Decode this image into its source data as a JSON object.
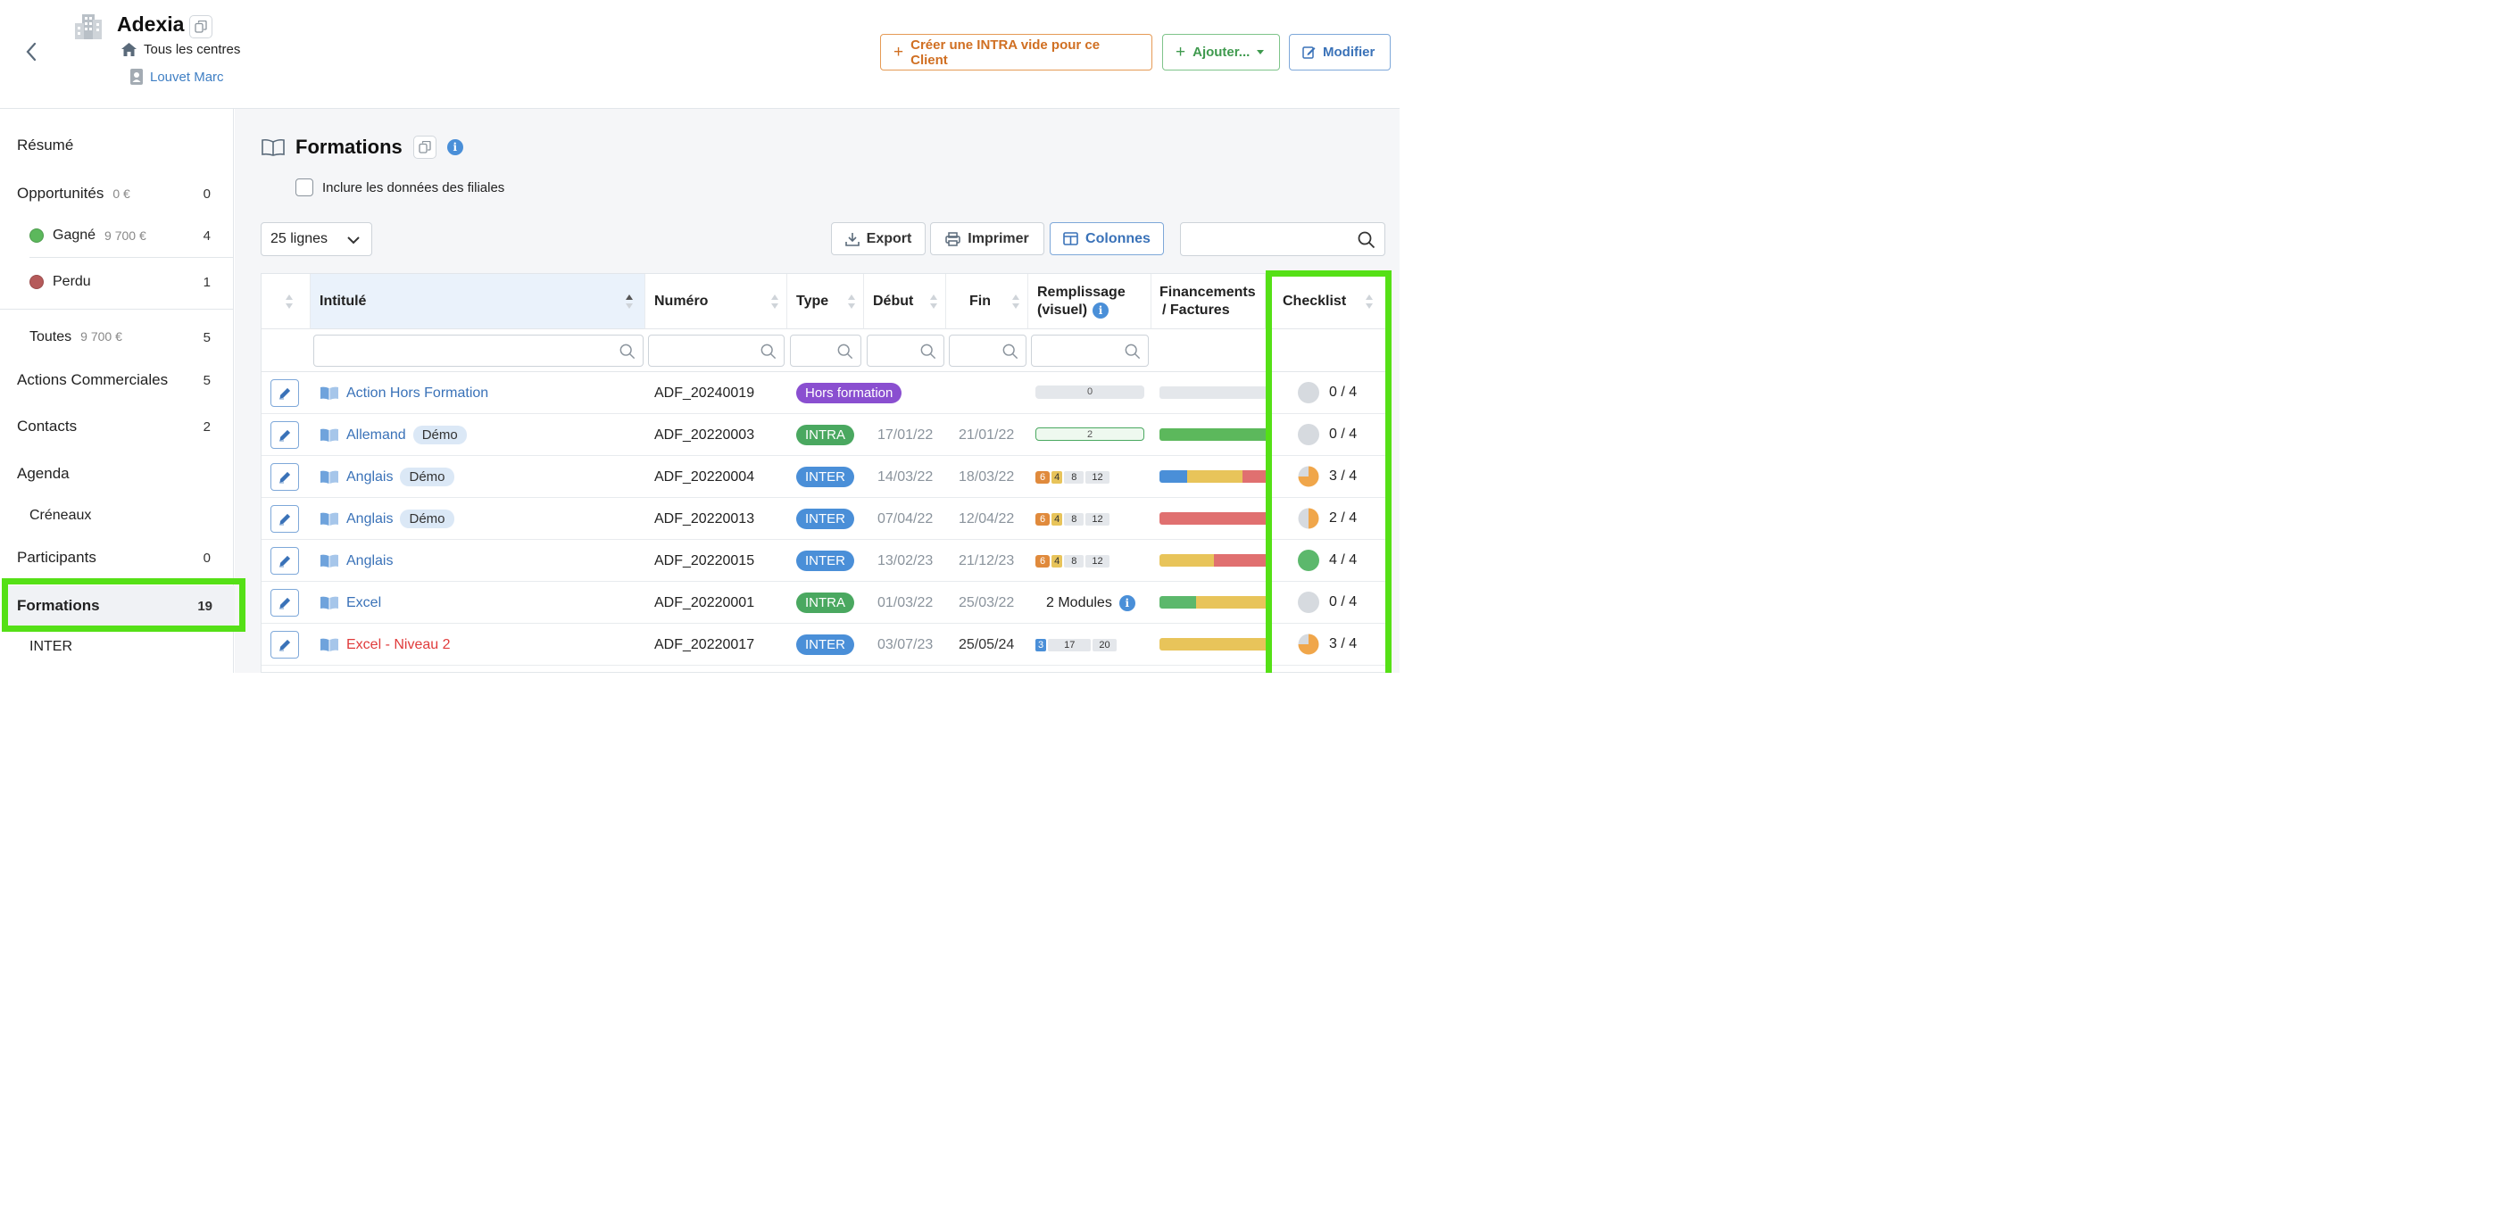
{
  "header": {
    "company": "Adexia",
    "center": "Tous les centres",
    "owner": "Louvet Marc",
    "buttons": {
      "create": "Créer une INTRA vide pour ce Client",
      "add": "Ajouter...",
      "edit": "Modifier"
    }
  },
  "sidebar": {
    "resume": "Résumé",
    "opportunites": {
      "label": "Opportunités",
      "amount": "0 €",
      "count": "0"
    },
    "gagne": {
      "label": "Gagné",
      "amount": "9 700 €",
      "count": "4"
    },
    "perdu": {
      "label": "Perdu",
      "count": "1"
    },
    "toutes": {
      "label": "Toutes",
      "amount": "9 700 €",
      "count": "5"
    },
    "actions": {
      "label": "Actions Commerciales",
      "count": "5"
    },
    "contacts": {
      "label": "Contacts",
      "count": "2"
    },
    "agenda": "Agenda",
    "creneaux": "Créneaux",
    "participants": {
      "label": "Participants",
      "count": "0"
    },
    "formations": {
      "label": "Formations",
      "count": "19"
    },
    "inter": "INTER",
    "colors": {
      "gagne": "#5cb85c",
      "perdu": "#b55a5a"
    }
  },
  "main": {
    "title": "Formations",
    "include_label": "Inclure les données des filiales",
    "rows_select": "25 lignes",
    "export": "Export",
    "print": "Imprimer",
    "columns": "Colonnes",
    "search_placeholder": ""
  },
  "table": {
    "headers": {
      "intitule": "Intitulé",
      "numero": "Numéro",
      "type": "Type",
      "debut": "Début",
      "fin": "Fin",
      "remplissage1": "Remplissage",
      "remplissage2": "(visuel)",
      "financements1": "Financements",
      "financements2": "/ Factures",
      "checklist": "Checklist"
    },
    "rows": [
      {
        "title": "Action Hors Formation",
        "demo": "",
        "numero": "ADF_20240019",
        "type": "Hors formation",
        "debut": "",
        "fin": "",
        "fill": "0",
        "checklist": "0 / 4"
      },
      {
        "title": "Allemand",
        "demo": "Démo",
        "numero": "ADF_20220003",
        "type": "INTRA",
        "debut": "17/01/22",
        "fin": "21/01/22",
        "fill": "2",
        "checklist": "0 / 4"
      },
      {
        "title": "Anglais",
        "demo": "Démo",
        "numero": "ADF_20220004",
        "type": "INTER",
        "debut": "14/03/22",
        "fin": "18/03/22",
        "fill": [
          "6",
          "4",
          "8",
          "12"
        ],
        "checklist": "3 / 4"
      },
      {
        "title": "Anglais",
        "demo": "Démo",
        "numero": "ADF_20220013",
        "type": "INTER",
        "debut": "07/04/22",
        "fin": "12/04/22",
        "fill": [
          "6",
          "4",
          "8",
          "12"
        ],
        "checklist": "2 / 4"
      },
      {
        "title": "Anglais",
        "demo": "",
        "numero": "ADF_20220015",
        "type": "INTER",
        "debut": "13/02/23",
        "fin": "21/12/23",
        "fill": [
          "6",
          "4",
          "8",
          "12"
        ],
        "checklist": "4 / 4"
      },
      {
        "title": "Excel",
        "demo": "",
        "numero": "ADF_20220001",
        "type": "INTRA",
        "debut": "01/03/22",
        "fin": "25/03/22",
        "fill": "2 Modules",
        "checklist": "0 / 4"
      },
      {
        "title": "Excel - Niveau 2",
        "demo": "",
        "numero": "ADF_20220017",
        "type": "INTER",
        "debut": "03/07/23",
        "fin": "25/05/24",
        "fill": [
          "3",
          "17",
          "20"
        ],
        "checklist": "3 / 4"
      }
    ]
  },
  "colors": {
    "hors_formation": "#8a4fd0",
    "intra": "#4aa860",
    "inter": "#4a8fd8",
    "highlight": "#55e016"
  }
}
